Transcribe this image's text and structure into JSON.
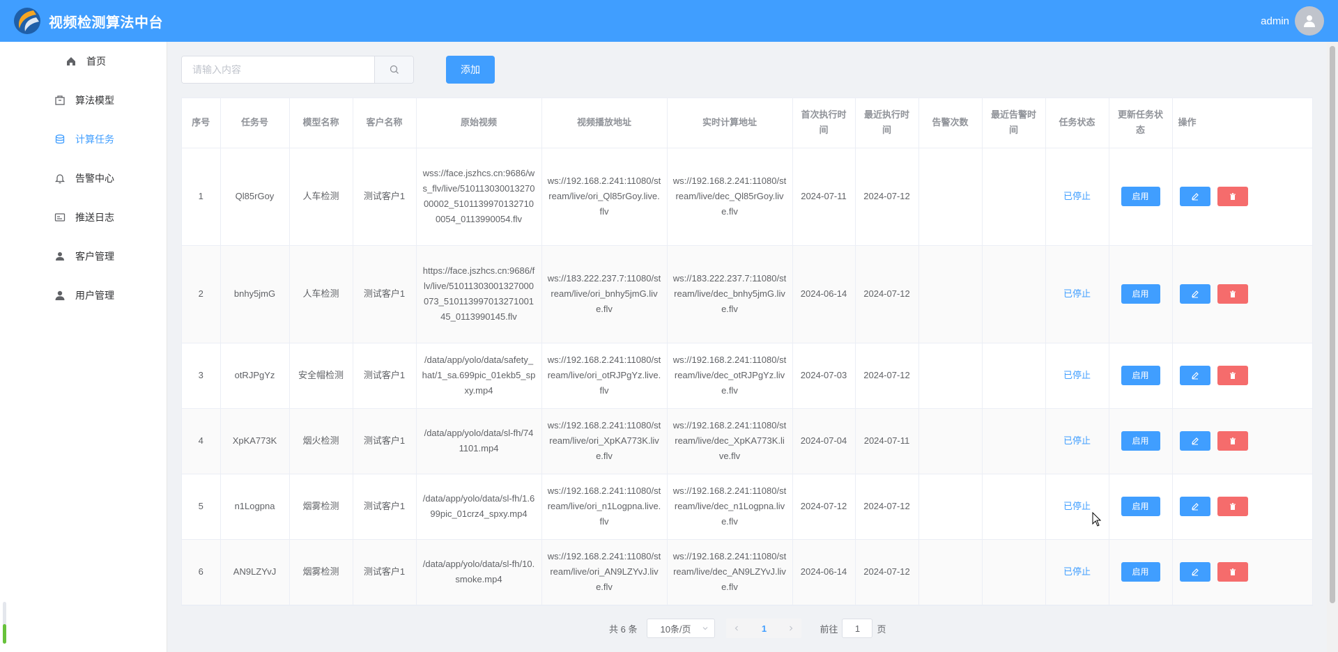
{
  "app": {
    "title": "视频检测算法中台",
    "username": "admin"
  },
  "sidebar": {
    "items": [
      {
        "label": "首页",
        "icon": "home-icon"
      },
      {
        "label": "算法模型",
        "icon": "box-icon"
      },
      {
        "label": "计算任务",
        "icon": "database-icon",
        "active": true
      },
      {
        "label": "告警中心",
        "icon": "bell-icon"
      },
      {
        "label": "推送日志",
        "icon": "log-icon"
      },
      {
        "label": "客户管理",
        "icon": "person-icon"
      },
      {
        "label": "用户管理",
        "icon": "user-icon"
      }
    ]
  },
  "toolbar": {
    "search_placeholder": "请输入内容",
    "add_label": "添加"
  },
  "table": {
    "headers": [
      "序号",
      "任务号",
      "模型名称",
      "客户名称",
      "原始视频",
      "视频播放地址",
      "实时计算地址",
      "首次执行时间",
      "最近执行时间",
      "告警次数",
      "最近告警时间",
      "任务状态",
      "更新任务状态",
      "操作"
    ],
    "rows": [
      {
        "idx": "1",
        "task_id": "Ql85rGoy",
        "model": "人车检测",
        "customer": "测试客户1",
        "source": "wss://face.jszhcs.cn:9686/ws_flv/live/51011303001327000002_51011399701327100054_0113990054.flv",
        "play_url": "ws://192.168.2.241:11080/stream/live/ori_Ql85rGoy.live.flv",
        "compute_url": "ws://192.168.2.241:11080/stream/live/dec_Ql85rGoy.live.flv",
        "first_exec": "2024-07-11",
        "last_exec": "2024-07-12",
        "alarm_count": "",
        "last_alarm": "",
        "status": "已停止",
        "action_label": "启用"
      },
      {
        "idx": "2",
        "task_id": "bnhy5jmG",
        "model": "人车检测",
        "customer": "测试客户1",
        "source": "https://face.jszhcs.cn:9686/flv/live/51011303001327000073_51011399701327100145_0113990145.flv",
        "play_url": "ws://183.222.237.7:11080/stream/live/ori_bnhy5jmG.live.flv",
        "compute_url": "ws://183.222.237.7:11080/stream/live/dec_bnhy5jmG.live.flv",
        "first_exec": "2024-06-14",
        "last_exec": "2024-07-12",
        "alarm_count": "",
        "last_alarm": "",
        "status": "已停止",
        "action_label": "启用"
      },
      {
        "idx": "3",
        "task_id": "otRJPgYz",
        "model": "安全帽检测",
        "customer": "测试客户1",
        "source": "/data/app/yolo/data/safety_hat/1_sa.699pic_01ekb5_spxy.mp4",
        "play_url": "ws://192.168.2.241:11080/stream/live/ori_otRJPgYz.live.flv",
        "compute_url": "ws://192.168.2.241:11080/stream/live/dec_otRJPgYz.live.flv",
        "first_exec": "2024-07-03",
        "last_exec": "2024-07-12",
        "alarm_count": "",
        "last_alarm": "",
        "status": "已停止",
        "action_label": "启用"
      },
      {
        "idx": "4",
        "task_id": "XpKA773K",
        "model": "烟火检测",
        "customer": "测试客户1",
        "source": "/data/app/yolo/data/sl-fh/741101.mp4",
        "play_url": "ws://192.168.2.241:11080/stream/live/ori_XpKA773K.live.flv",
        "compute_url": "ws://192.168.2.241:11080/stream/live/dec_XpKA773K.live.flv",
        "first_exec": "2024-07-04",
        "last_exec": "2024-07-11",
        "alarm_count": "",
        "last_alarm": "",
        "status": "已停止",
        "action_label": "启用"
      },
      {
        "idx": "5",
        "task_id": "n1Logpna",
        "model": "烟雾检测",
        "customer": "测试客户1",
        "source": "/data/app/yolo/data/sl-fh/1.699pic_01crz4_spxy.mp4",
        "play_url": "ws://192.168.2.241:11080/stream/live/ori_n1Logpna.live.flv",
        "compute_url": "ws://192.168.2.241:11080/stream/live/dec_n1Logpna.live.flv",
        "first_exec": "2024-07-12",
        "last_exec": "2024-07-12",
        "alarm_count": "",
        "last_alarm": "",
        "status": "已停止",
        "action_label": "启用"
      },
      {
        "idx": "6",
        "task_id": "AN9LZYvJ",
        "model": "烟雾检测",
        "customer": "测试客户1",
        "source": "/data/app/yolo/data/sl-fh/10.smoke.mp4",
        "play_url": "ws://192.168.2.241:11080/stream/live/ori_AN9LZYvJ.live.flv",
        "compute_url": "ws://192.168.2.241:11080/stream/live/dec_AN9LZYvJ.live.flv",
        "first_exec": "2024-06-14",
        "last_exec": "2024-07-12",
        "alarm_count": "",
        "last_alarm": "",
        "status": "已停止",
        "action_label": "启用"
      }
    ]
  },
  "pagination": {
    "total": "共 6 条",
    "page_size": "10条/页",
    "current": "1",
    "goto_prefix": "前往",
    "goto_value": "1",
    "goto_suffix": "页"
  },
  "colors": {
    "primary": "#409eff",
    "danger": "#f56c6c",
    "header_bg": "#409eff"
  }
}
